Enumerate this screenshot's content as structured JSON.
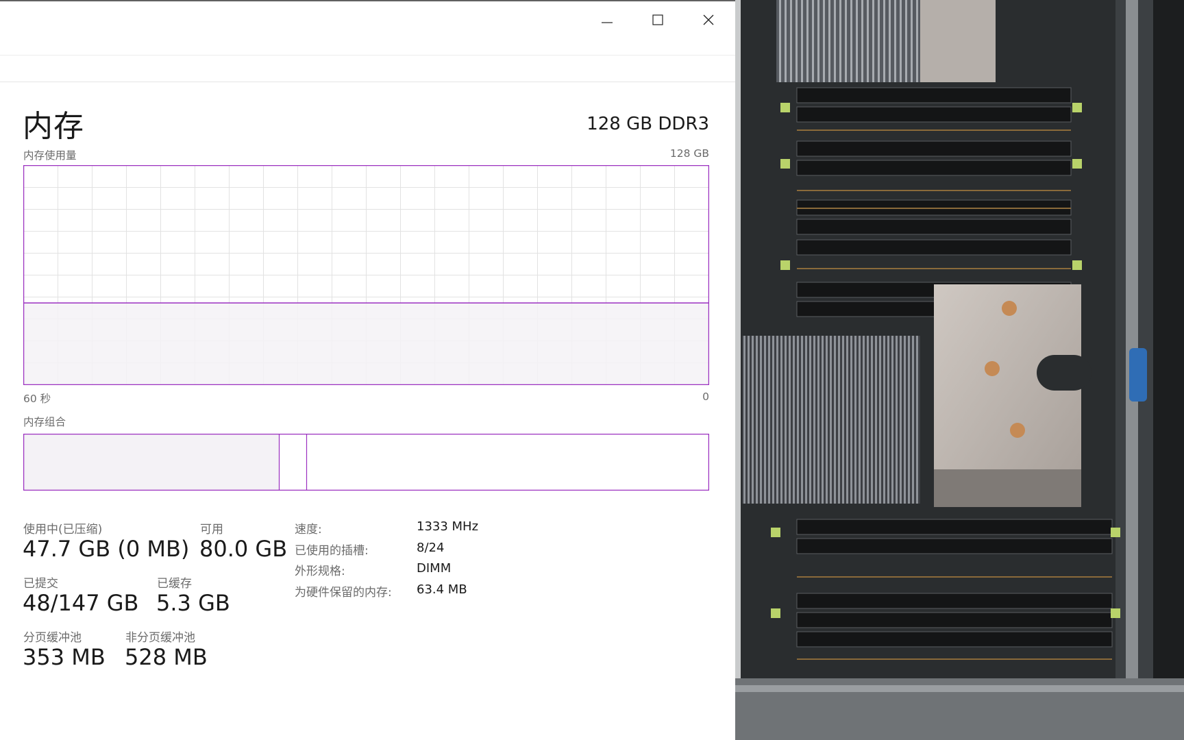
{
  "window": {
    "controls": {
      "minimize": "minimize-icon",
      "maximize": "maximize-icon",
      "close": "close-icon"
    }
  },
  "memory": {
    "title": "内存",
    "spec": "128 GB DDR3",
    "usage_graph": {
      "label": "内存使用量",
      "max_label": "128 GB",
      "time_left": "60 秒",
      "time_right": "0",
      "used_fraction": 0.373
    },
    "composition": {
      "label": "内存组合",
      "in_use_fraction": 0.373,
      "modified_fraction": 0.04
    },
    "stats": {
      "in_use_label": "使用中(已压缩)",
      "in_use_value": "47.7 GB (0 MB)",
      "available_label": "可用",
      "available_value": "80.0 GB",
      "committed_label": "已提交",
      "committed_value": "48/147 GB",
      "cached_label": "已缓存",
      "cached_value": "5.3 GB",
      "paged_pool_label": "分页缓冲池",
      "paged_pool_value": "353 MB",
      "nonpaged_pool_label": "非分页缓冲池",
      "nonpaged_pool_value": "528 MB"
    },
    "details": [
      {
        "label": "速度:",
        "value": "1333 MHz"
      },
      {
        "label": "已使用的插槽:",
        "value": "8/24"
      },
      {
        "label": "外形规格:",
        "value": "DIMM"
      },
      {
        "label": "为硬件保留的内存:",
        "value": "63.4 MB"
      }
    ]
  },
  "colors": {
    "accent": "#9b30c0",
    "graph_fill": "#f4f2f6",
    "grid": "#e2e2e2"
  }
}
